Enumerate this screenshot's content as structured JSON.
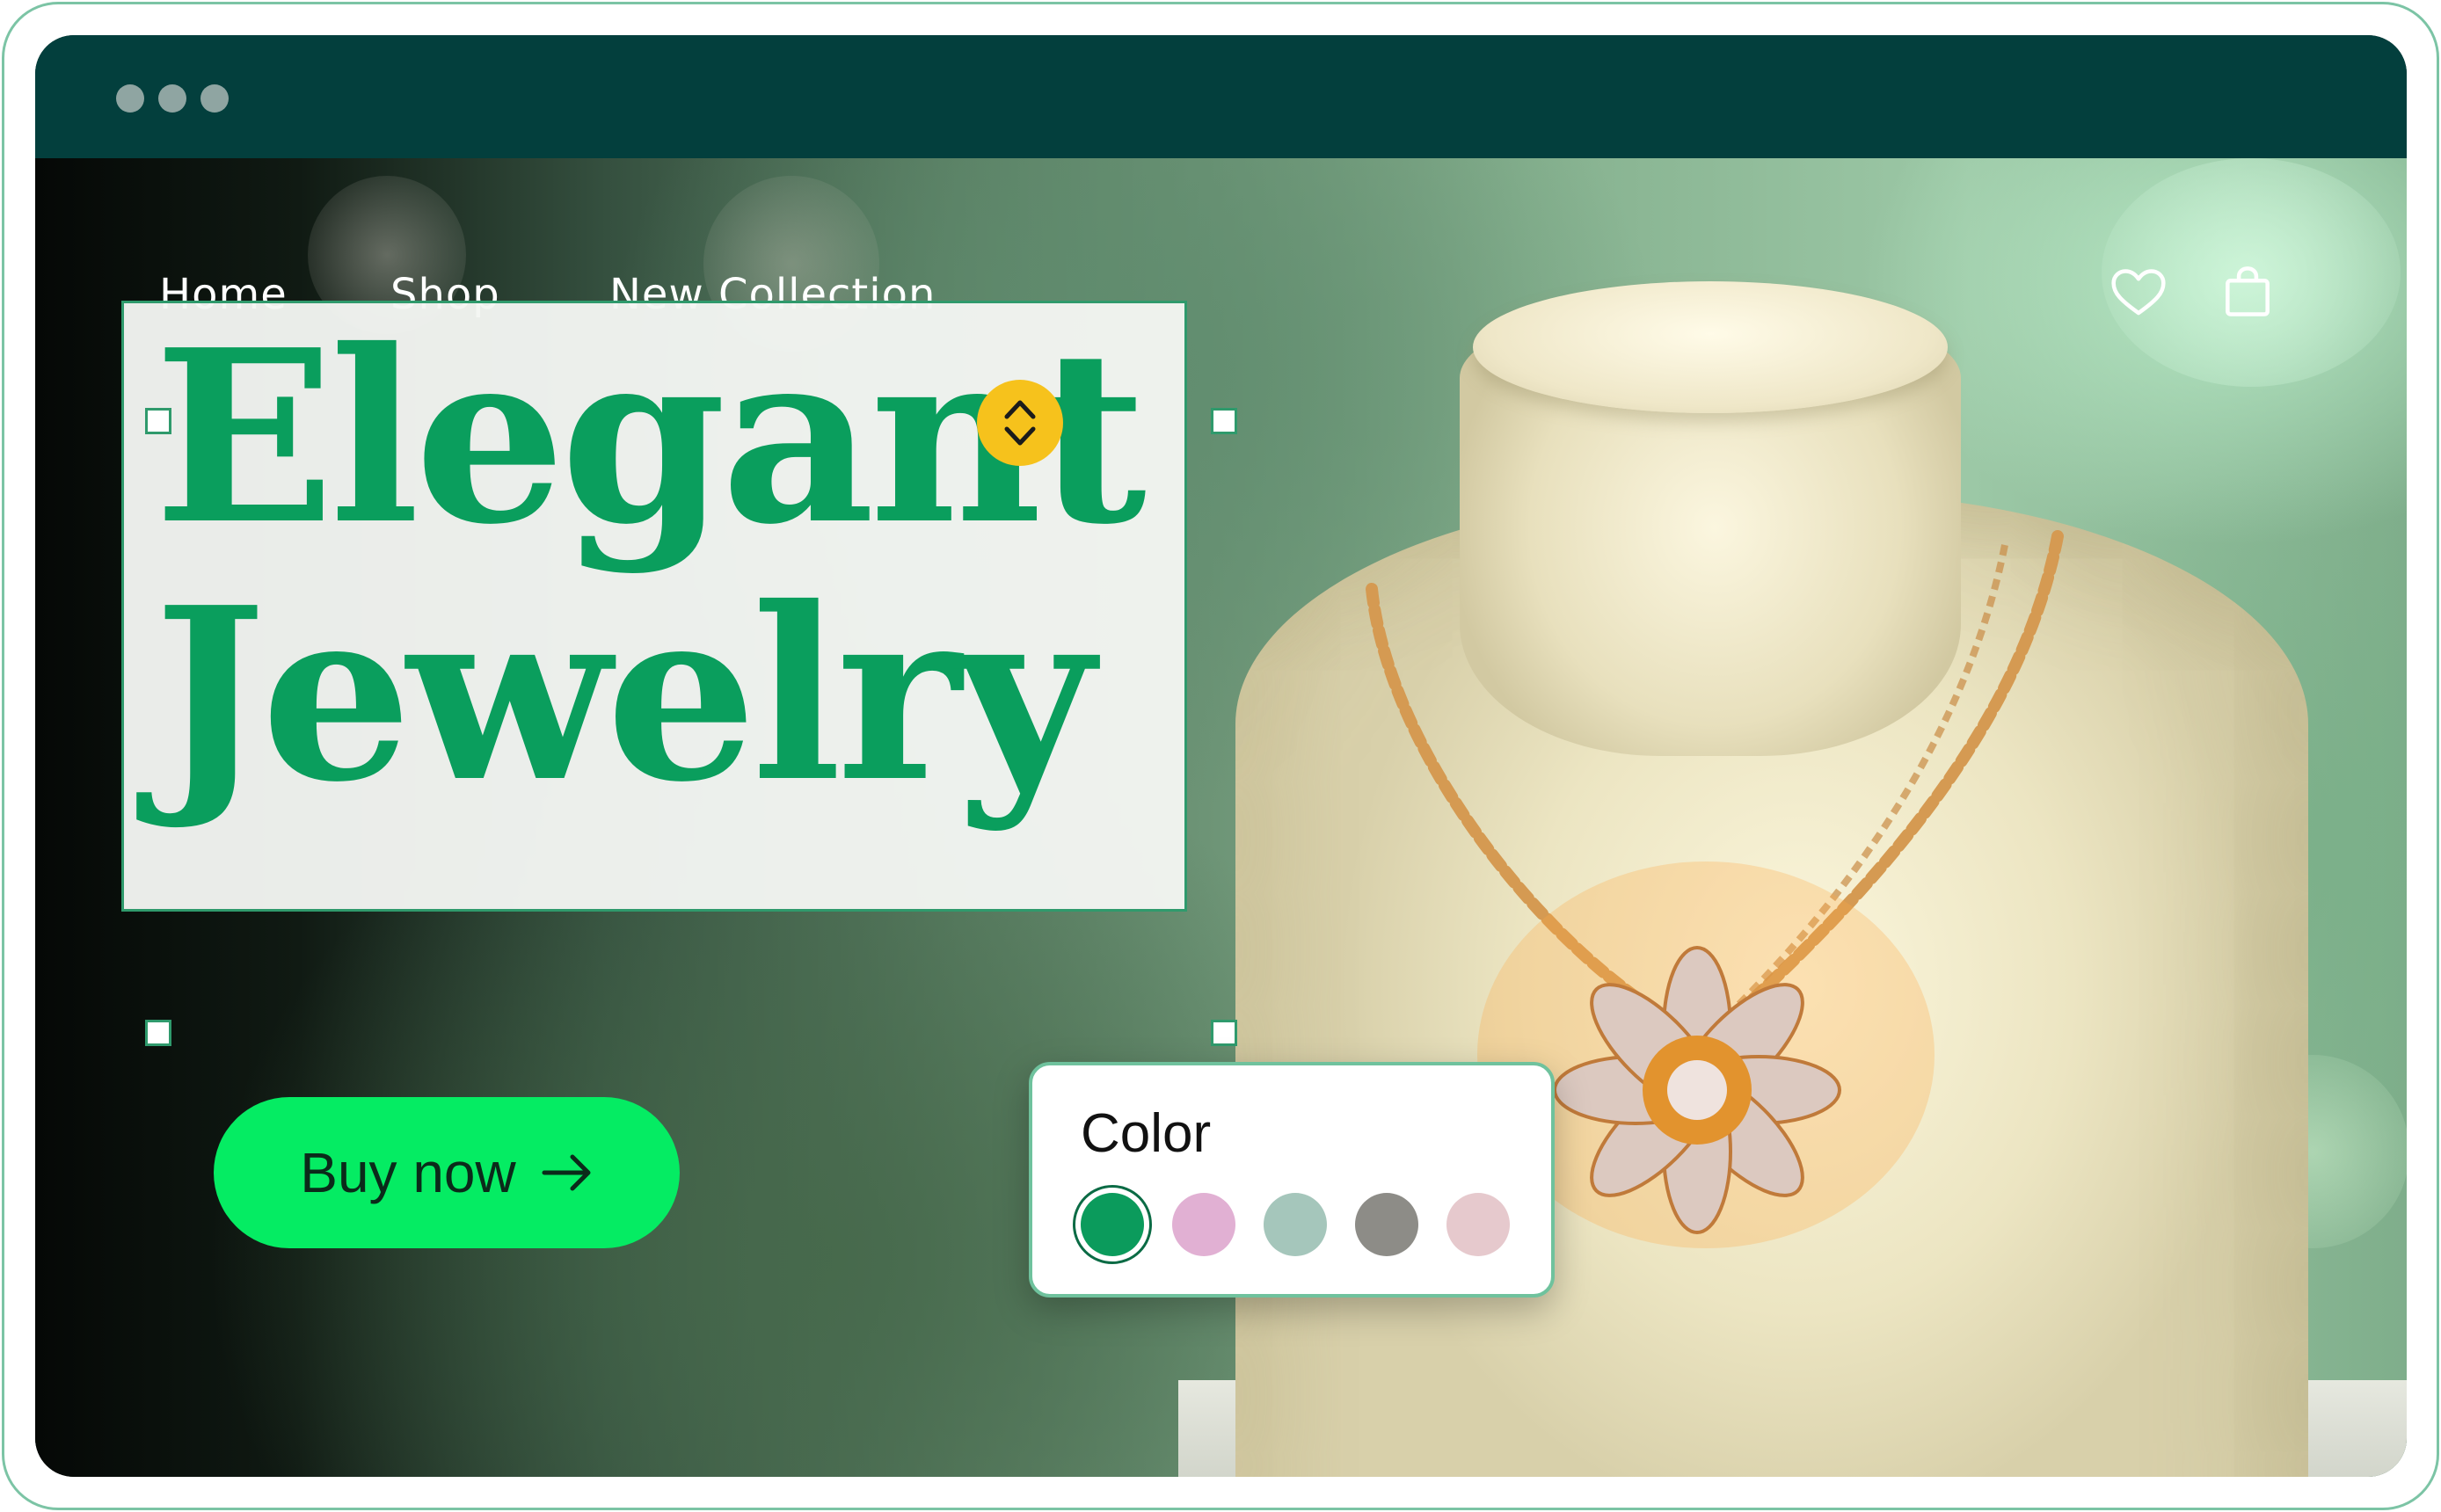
{
  "nav": {
    "links": [
      "Home",
      "Shop",
      "New Collection"
    ],
    "icons": [
      "heart-icon",
      "shopping-bag-icon"
    ]
  },
  "hero": {
    "headline_line1": "Elegant",
    "headline_line2": "Jewelry",
    "cta_label": "Buy now",
    "cta_icon": "arrow-right-icon"
  },
  "color_picker": {
    "title": "Color",
    "selected_index": 0,
    "swatches": [
      "#0b9b5c",
      "#e1b0d3",
      "#a5c6bb",
      "#8d8c87",
      "#e6c9cd"
    ]
  },
  "colors": {
    "brand_green": "#0a9e5d",
    "cta_green": "#05ec63",
    "titlebar": "#033f3d",
    "frame_border": "#7cc4a5",
    "handle_accent": "#f6c21c"
  }
}
